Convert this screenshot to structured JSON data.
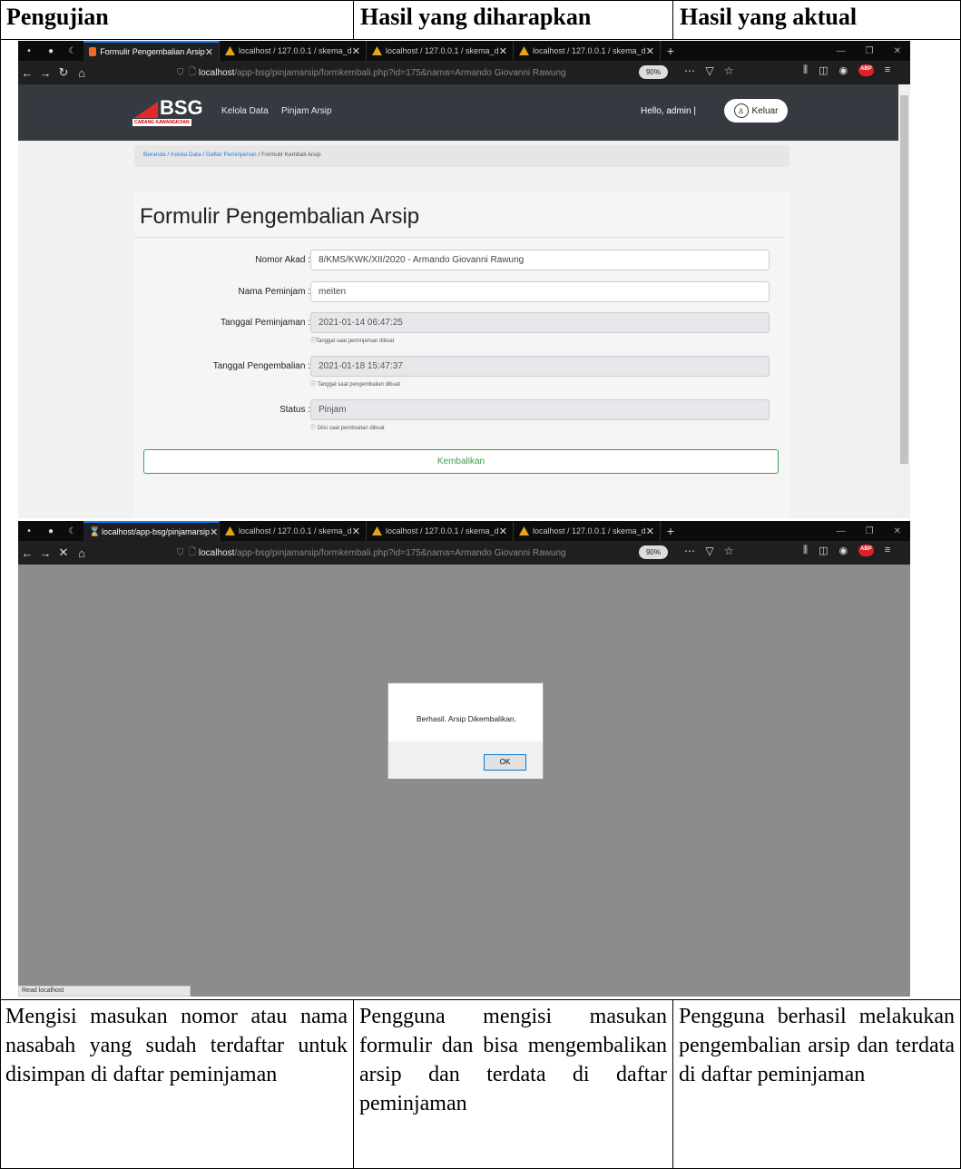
{
  "table": {
    "headers": [
      "Pengujian",
      "Hasil yang diharapkan",
      "Hasil yang aktual"
    ],
    "body": [
      "Mengisi masukan nomor atau nama nasabah yang sudah terdaftar untuk disimpan di daftar peminjaman",
      "Pengguna mengisi masukan formulir dan bisa mengembalikan arsip dan terdata di daftar peminjaman",
      "Pengguna berhasil melakukan pengembalian arsip dan terdata di daftar peminjaman"
    ]
  },
  "browser1": {
    "tabs": [
      "Formulir Pengembalian Arsip",
      "localhost / 127.0.0.1 / skema_d",
      "localhost / 127.0.0.1 / skema_d",
      "localhost / 127.0.0.1 / skema_d"
    ],
    "url_host": "localhost",
    "url_path": "/app-bsg/pinjamarsip/formkembali.php?id=175&nama=Armando Giovanni Rawung",
    "zoom": "90%"
  },
  "app": {
    "logo": "BSG",
    "logo_sub": "CABANG KAWANGKOAN",
    "nav": [
      "Kelola Data",
      "Pinjam Arsip"
    ],
    "hello": "Hello, admin |",
    "logout": "Keluar",
    "breadcrumb": [
      "Beranda",
      "Kelola Data",
      "Daftar Peminjaman",
      "Formulir Kembali Arsip"
    ],
    "form_title": "Formulir Pengembalian Arsip",
    "fields": [
      {
        "label": "Nomor Akad :",
        "value": "8/KMS/KWK/XII/2020 - Armando Giovanni Rawung",
        "help": ""
      },
      {
        "label": "Nama Peminjam :",
        "value": "meiten",
        "help": ""
      },
      {
        "label": "Tanggal Peminjaman :",
        "value": "2021-01-14 06:47:25",
        "help": "Tanggal saat peminjaman dibuat"
      },
      {
        "label": "Tanggal Pengembalian :",
        "value": "2021-01-18 15:47:37",
        "help": "Tanggal saat pengembalian dibuat"
      },
      {
        "label": "Status :",
        "value": "Pinjam",
        "help": "Diisi saat pembuatan dibuat"
      }
    ],
    "submit": "Kembalikan"
  },
  "browser2": {
    "tabs": [
      "localhost/app-bsg/pinjamarsip",
      "localhost / 127.0.0.1 / skema_d",
      "localhost / 127.0.0.1 / skema_d",
      "localhost / 127.0.0.1 / skema_d"
    ],
    "url_host": "localhost",
    "url_path": "/app-bsg/pinjamarsip/formkembali.php?id=175&nama=Armando Giovanni Rawung",
    "zoom": "90%",
    "dialog_message": "Berhasil. Arsip Dikembalikan.",
    "dialog_ok": "OK",
    "status": "Read localhost"
  }
}
